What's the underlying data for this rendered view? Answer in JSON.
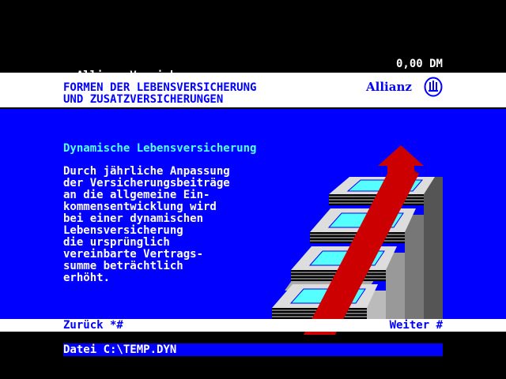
{
  "topbar": {
    "company": "Allianz Versicherungen",
    "amount": "0,00 DM"
  },
  "header": {
    "title_line1": "FORMEN DER LEBENSVERSICHERUNG",
    "title_line2": "UND ZUSATZVERSICHERUNGEN",
    "logo_text": "Allianz"
  },
  "main": {
    "heading": "Dynamische Lebensversicherung",
    "body_lines": [
      "Durch jährliche Anpassung",
      "der Versicherungsbeiträge",
      "an die allgemeine Ein-",
      "kommensentwicklung wird",
      "bei einer dynamischen",
      "Lebensversicherung",
      "die ursprünglich",
      "vereinbarte Vertrags-",
      "summe beträchtlich",
      "erhöht."
    ]
  },
  "nav": {
    "back_label": "Zurück *#",
    "next_label": "Weiter #"
  },
  "status": {
    "file_label": "Datei C:\\TEMP.DYN"
  },
  "colors": {
    "blue": "#0000ff",
    "cyan": "#55ffff",
    "red": "#cc0000",
    "white": "#ffffff",
    "black": "#000000"
  }
}
